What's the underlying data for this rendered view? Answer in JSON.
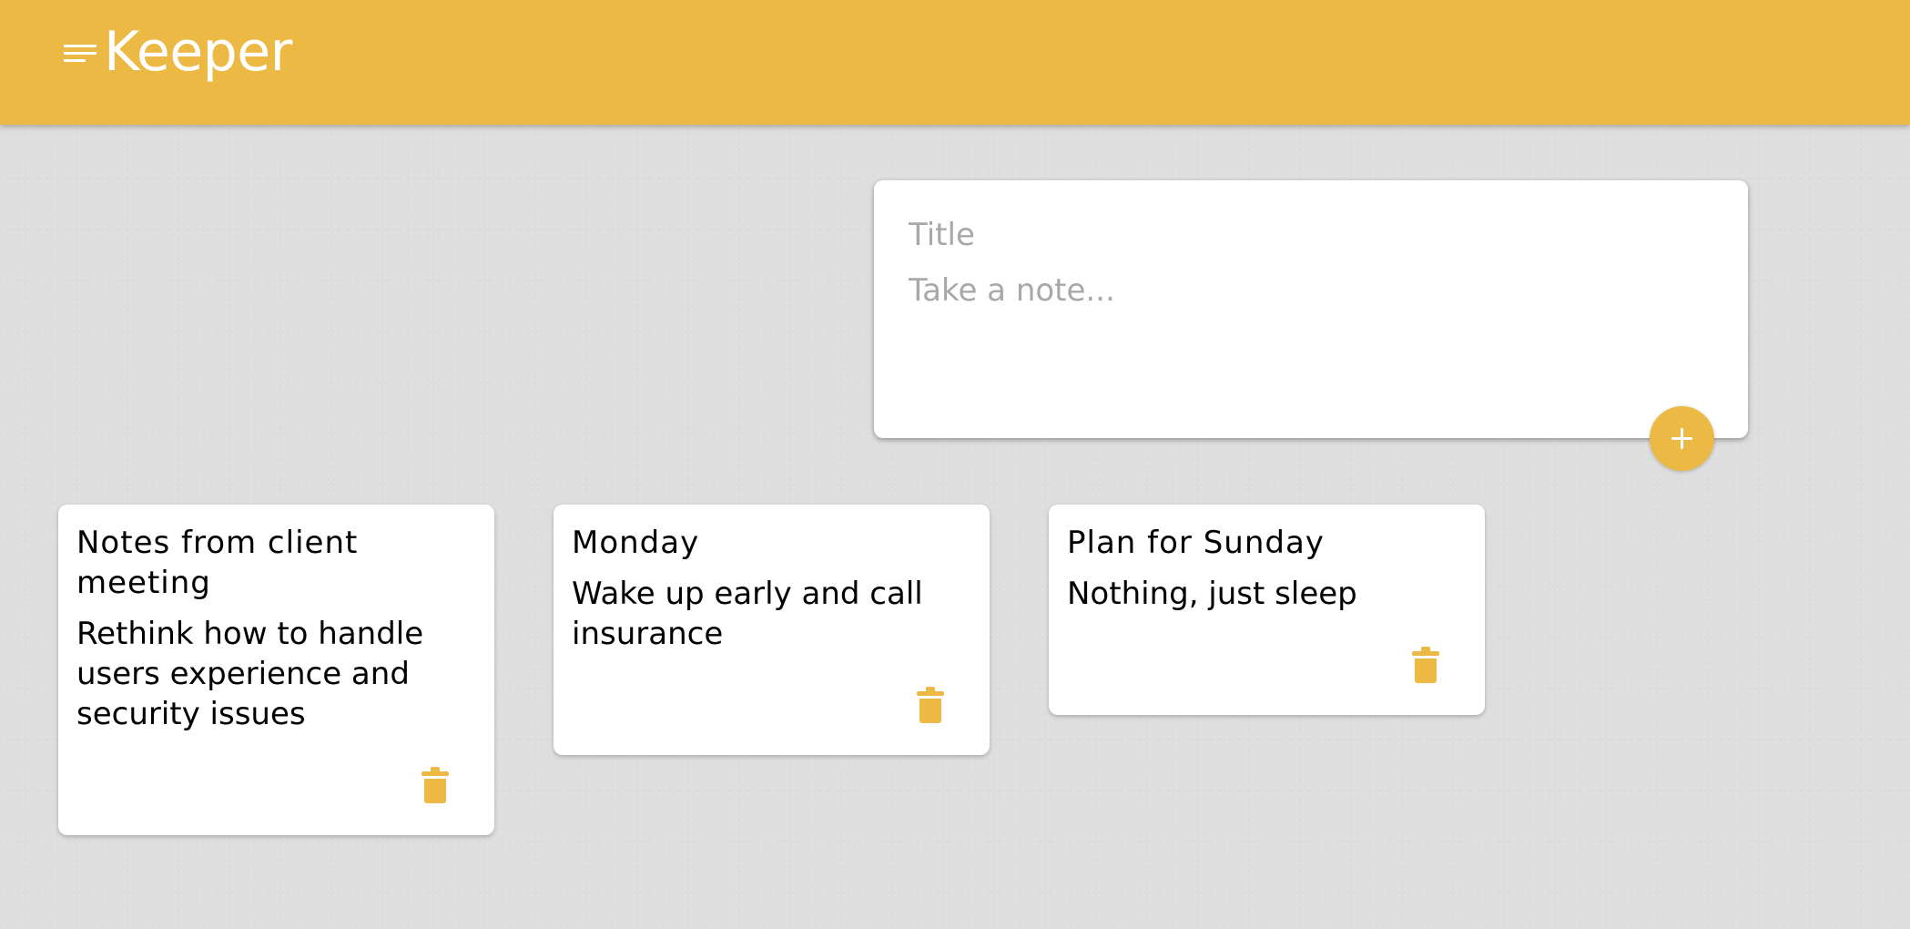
{
  "app": {
    "brand": "Keeper",
    "menu_icon": "menu-icon"
  },
  "composer": {
    "title_placeholder": "Title",
    "content_placeholder": "Take a note...",
    "add_icon": "plus-icon"
  },
  "notes": [
    {
      "title": "Notes from client meeting",
      "content": "Rethink how to handle users experience and security issues",
      "delete_icon": "trash-icon"
    },
    {
      "title": "Monday",
      "content": "Wake up early and call insurance",
      "delete_icon": "trash-icon"
    },
    {
      "title": "Plan for Sunday",
      "content": "Nothing, just sleep",
      "delete_icon": "trash-icon"
    }
  ],
  "theme": {
    "accent": "#ebb944",
    "background": "#dedede",
    "card": "#ffffff",
    "placeholder": "#a8a8a8"
  }
}
